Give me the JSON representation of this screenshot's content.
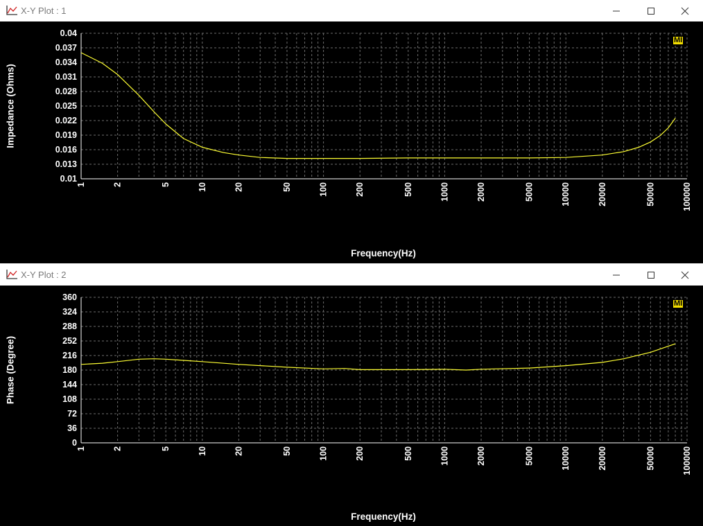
{
  "windows": [
    {
      "title": "X-Y Plot : 1",
      "badge": "MI"
    },
    {
      "title": "X-Y Plot : 2",
      "badge": "MI"
    }
  ],
  "colors": {
    "background": "#000000",
    "trace": "#ffff33",
    "grid": "#6e6e6e",
    "text": "#ffffff",
    "badge": "#f5e000"
  },
  "chart_data": [
    {
      "type": "line",
      "xlabel": "Frequency(Hz)",
      "ylabel": "Impedance (Ohms)",
      "xscale": "log",
      "xlim": [
        1,
        100000
      ],
      "ylim": [
        0.01,
        0.04
      ],
      "x_ticks": [
        "1",
        "2",
        "5",
        "10",
        "20",
        "50",
        "100",
        "200",
        "500",
        "1000",
        "2000",
        "5000",
        "10000",
        "20000",
        "50000",
        "100000"
      ],
      "y_ticks": [
        "0.01",
        "0.013",
        "0.016",
        "0.019",
        "0.022",
        "0.025",
        "0.028",
        "0.031",
        "0.034",
        "0.037",
        "0.04"
      ],
      "grid": true,
      "series": [
        {
          "x": [
            1,
            1.5,
            2,
            3,
            4,
            5,
            7,
            10,
            15,
            20,
            30,
            50,
            100,
            200,
            500,
            1000,
            2000,
            5000,
            10000,
            20000,
            30000,
            40000,
            50000,
            60000,
            70000,
            80000
          ],
          "y": [
            0.036,
            0.0338,
            0.0315,
            0.0272,
            0.0238,
            0.0213,
            0.0183,
            0.0165,
            0.0154,
            0.0149,
            0.0144,
            0.0142,
            0.0142,
            0.0142,
            0.0143,
            0.0143,
            0.0143,
            0.0143,
            0.0144,
            0.0149,
            0.0156,
            0.0165,
            0.0176,
            0.0189,
            0.0205,
            0.0225
          ]
        }
      ]
    },
    {
      "type": "line",
      "xlabel": "Frequency(Hz)",
      "ylabel": "Phase (Degree)",
      "xscale": "log",
      "xlim": [
        1,
        100000
      ],
      "ylim": [
        0,
        360
      ],
      "x_ticks": [
        "1",
        "2",
        "5",
        "10",
        "20",
        "50",
        "100",
        "200",
        "500",
        "1000",
        "2000",
        "5000",
        "10000",
        "20000",
        "50000",
        "100000"
      ],
      "y_ticks": [
        "0",
        "36",
        "72",
        "108",
        "144",
        "180",
        "216",
        "252",
        "288",
        "324",
        "360"
      ],
      "grid": true,
      "series": [
        {
          "x": [
            1,
            1.5,
            2,
            3,
            4,
            5,
            7,
            10,
            20,
            50,
            100,
            150,
            200,
            500,
            1000,
            1500,
            2000,
            5000,
            10000,
            20000,
            30000,
            50000,
            80000
          ],
          "y": [
            194,
            197,
            201,
            207,
            208,
            207,
            204,
            201,
            194,
            187,
            183,
            184,
            181,
            181,
            182,
            180,
            182,
            185,
            191,
            199,
            208,
            224,
            245
          ]
        }
      ]
    }
  ]
}
